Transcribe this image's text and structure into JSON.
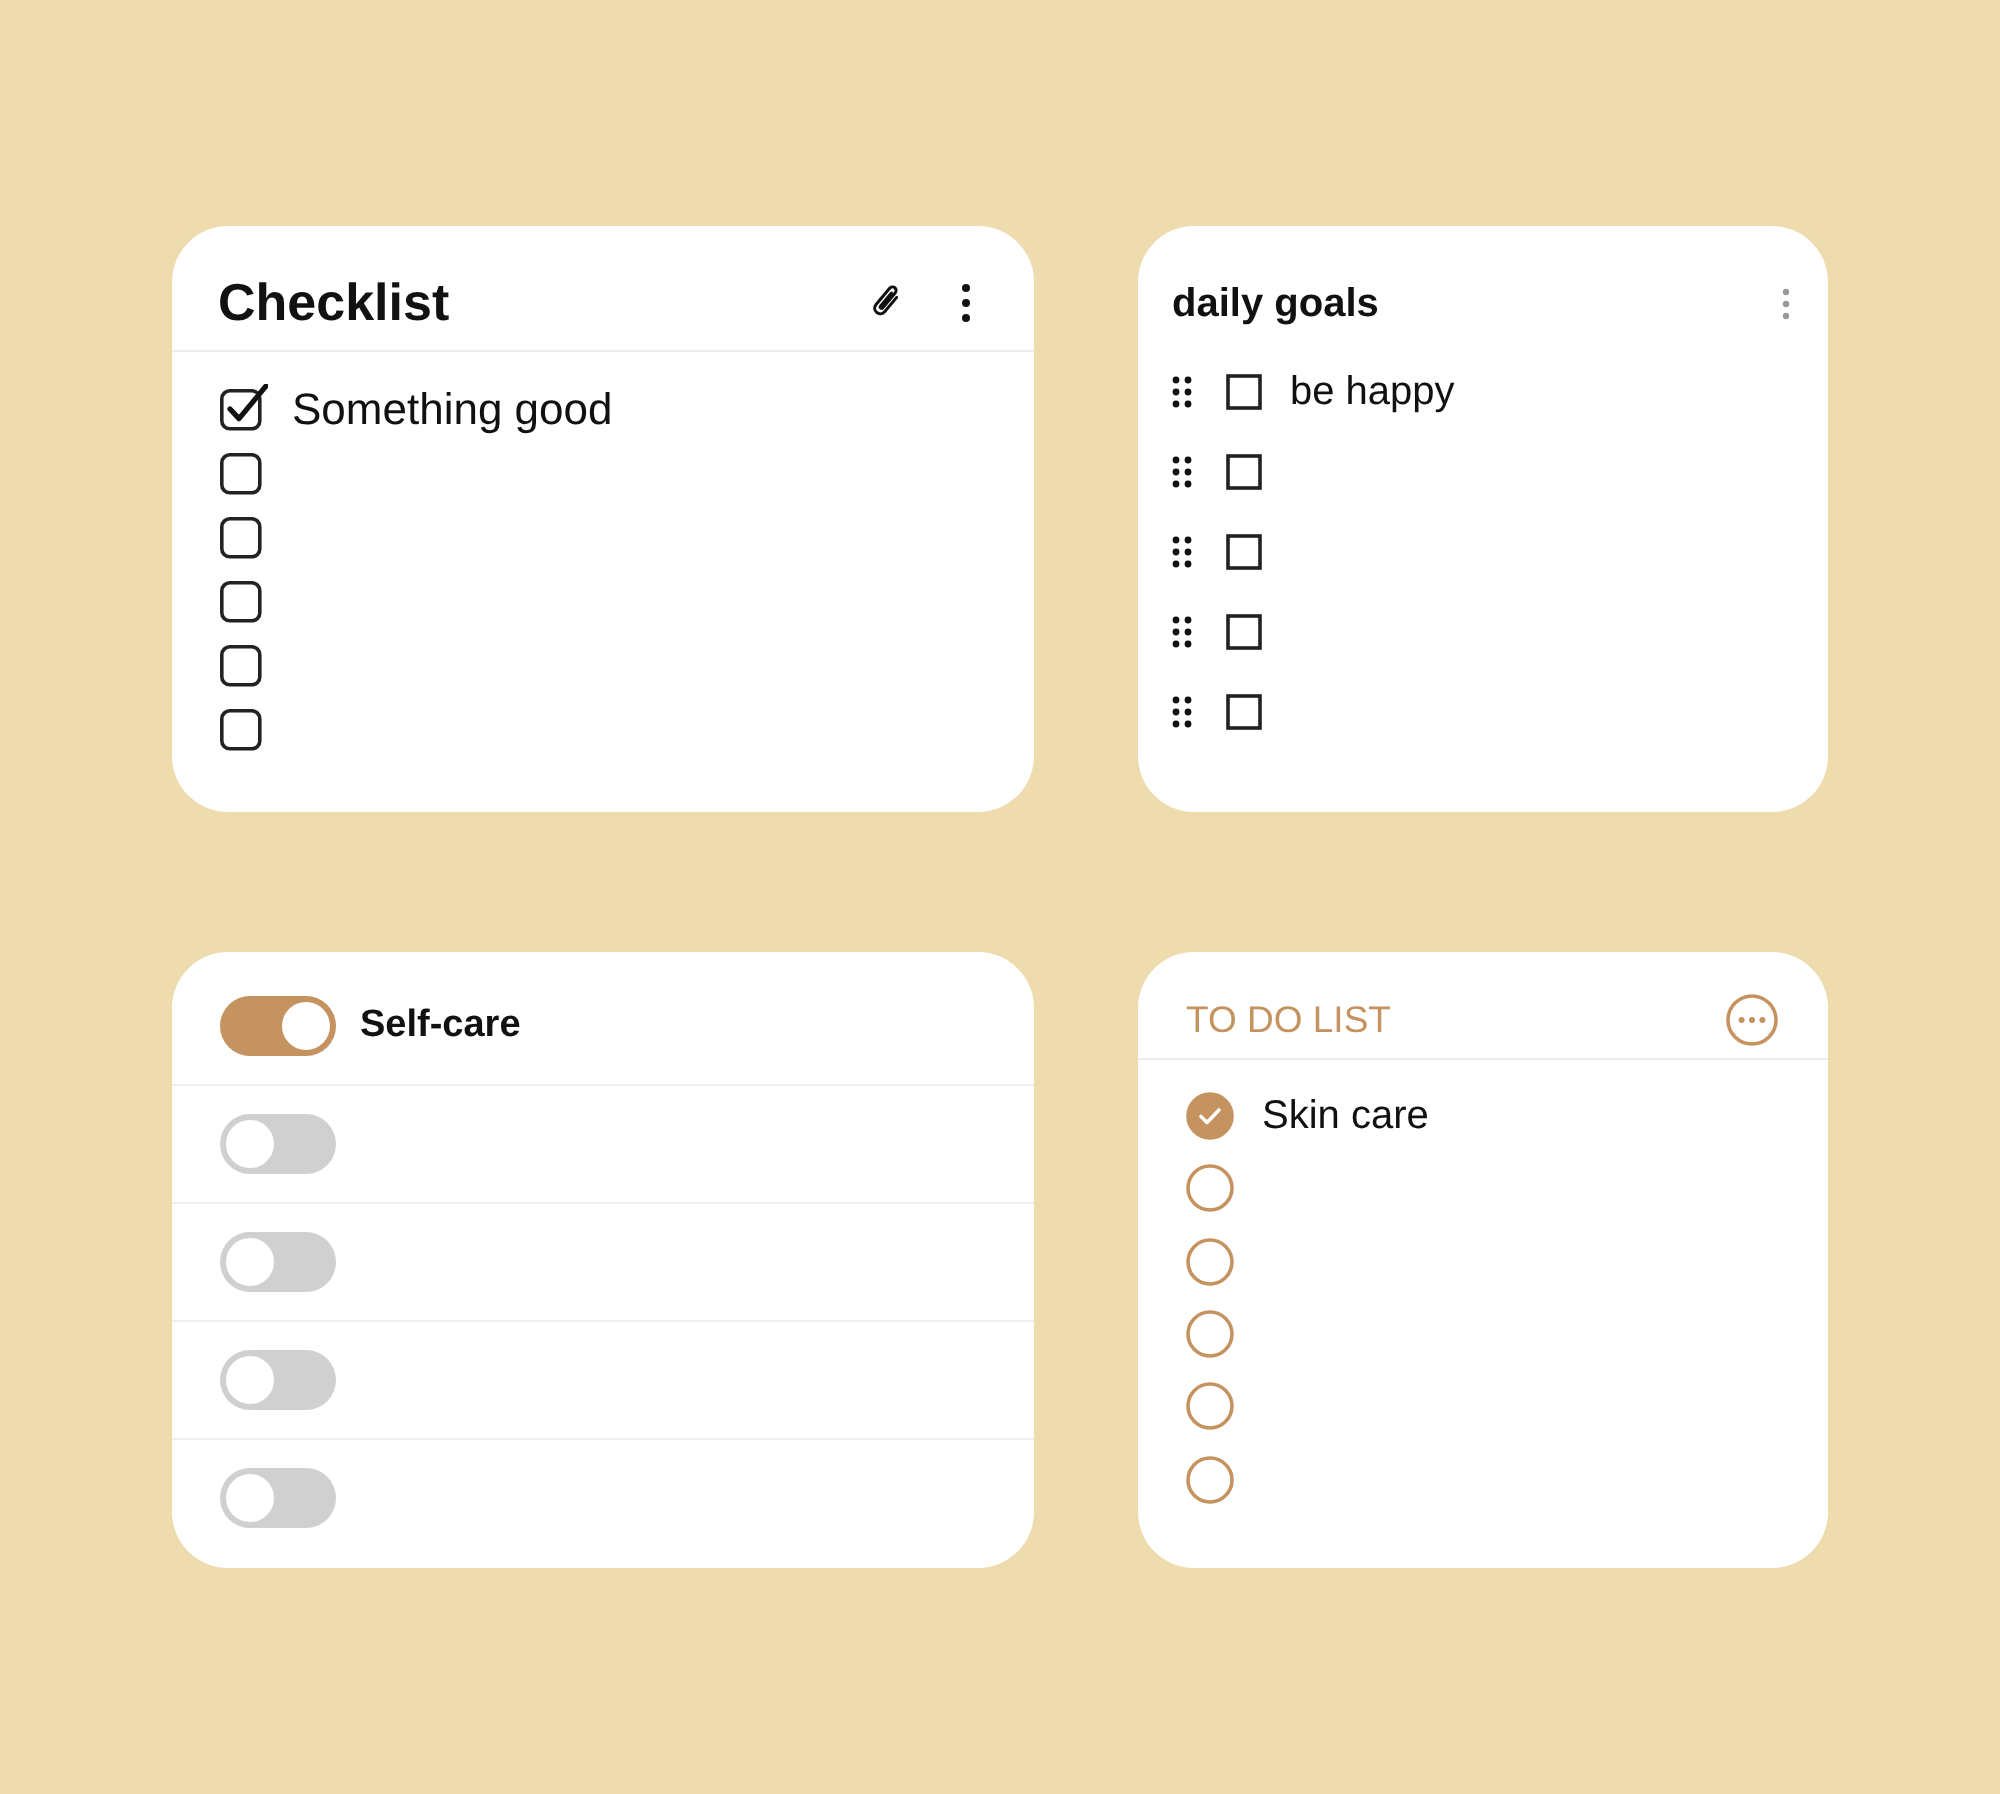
{
  "cards": [
    {
      "kind": "checklist",
      "title": "Checklist",
      "items": [
        {
          "text": "Something good",
          "checked": true
        },
        {
          "checked": false
        },
        {
          "checked": false
        },
        {
          "checked": false
        },
        {
          "checked": false
        },
        {
          "checked": false
        }
      ]
    },
    {
      "kind": "goals",
      "title": "daily goals",
      "items": [
        {
          "text": "be happy",
          "checked": false
        },
        {
          "checked": false
        },
        {
          "checked": false
        },
        {
          "checked": false
        },
        {
          "checked": false
        }
      ]
    },
    {
      "kind": "toggles",
      "items": [
        {
          "text": "Self-care",
          "on": true
        },
        {
          "on": false
        },
        {
          "on": false
        },
        {
          "on": false
        },
        {
          "on": false
        }
      ]
    },
    {
      "kind": "todo",
      "title": "TO DO LIST",
      "items": [
        {
          "text": "Skin care",
          "checked": true
        },
        {
          "checked": false
        },
        {
          "checked": false
        },
        {
          "checked": false
        },
        {
          "checked": false
        },
        {
          "checked": false
        }
      ]
    }
  ]
}
